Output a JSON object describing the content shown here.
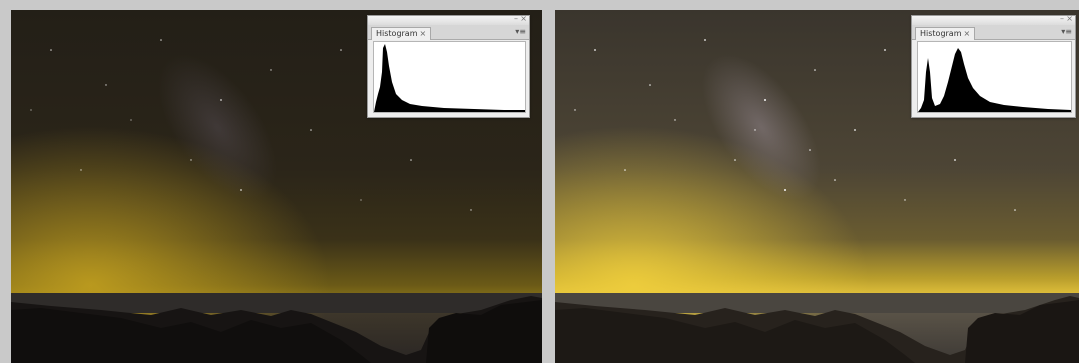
{
  "panels": [
    {
      "id": "before",
      "histogram": {
        "tab_label": "Histogram",
        "tab_close": "×",
        "minimize": "–",
        "close": "×",
        "menu": "▾≡"
      }
    },
    {
      "id": "after",
      "histogram": {
        "tab_label": "Histogram",
        "tab_close": "×",
        "minimize": "–",
        "close": "×",
        "menu": "▾≡"
      }
    }
  ],
  "colors": {
    "background": "#c9c9c9",
    "sky_dark": "#2a2418",
    "sky_light": "#4f4836",
    "horizon_glow": "#e3c23c",
    "ground": "#141111",
    "city_lights": "#fff6c8"
  },
  "icons": [
    "warning-icon",
    "panel-menu-icon",
    "minimize-icon",
    "close-icon"
  ]
}
